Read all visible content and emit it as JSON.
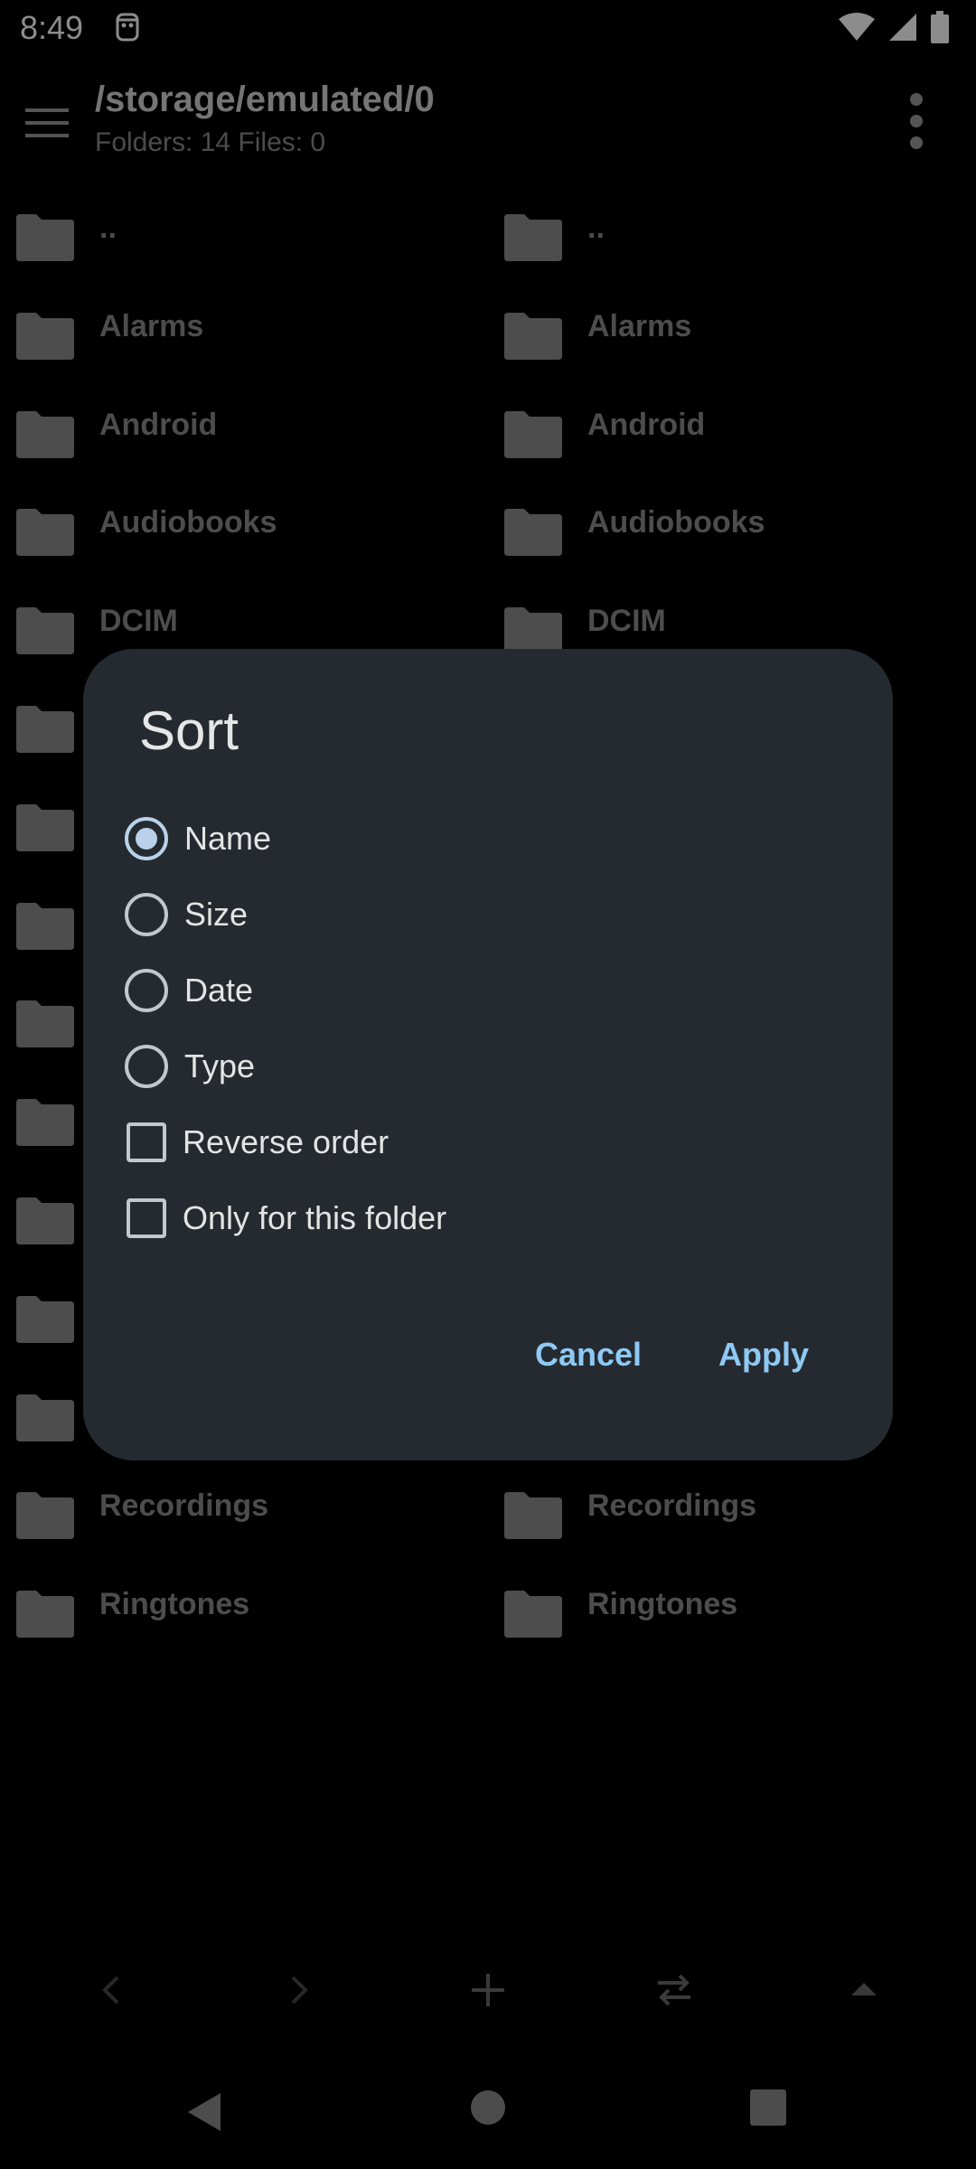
{
  "status_bar": {
    "time": "8:49"
  },
  "app_bar": {
    "path": "/storage/emulated/0",
    "summary": "Folders: 14 Files: 0"
  },
  "left_pane": {
    "items": [
      "..",
      "Alarms",
      "Android",
      "Audiobooks",
      "DCIM",
      "",
      "",
      "",
      "",
      "",
      "",
      "",
      "",
      "Recordings",
      "Ringtones"
    ]
  },
  "right_pane": {
    "items": [
      "..",
      "Alarms",
      "Android",
      "Audiobooks",
      "DCIM",
      "",
      "",
      "",
      "",
      "",
      "",
      "",
      "",
      "Recordings",
      "Ringtones"
    ]
  },
  "dialog": {
    "title": "Sort",
    "options": {
      "name": "Name",
      "size": "Size",
      "date": "Date",
      "type": "Type"
    },
    "selected": "name",
    "reverse_order": "Reverse order",
    "only_this_folder": "Only for this folder",
    "cancel": "Cancel",
    "apply": "Apply"
  },
  "colors": {
    "accent": "#8ec9f4",
    "dialog_bg": "#252a30",
    "radio_selected": "#b9d2ea"
  }
}
